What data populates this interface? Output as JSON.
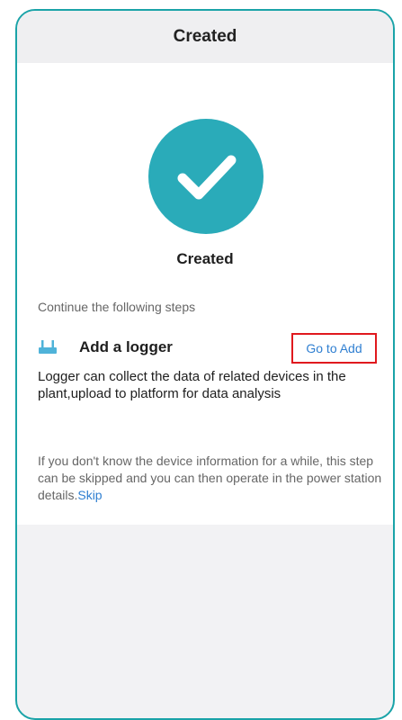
{
  "header": {
    "title": "Created"
  },
  "status": {
    "icon": "checkmark-circle-icon",
    "label": "Created"
  },
  "steps": {
    "intro": "Continue the following steps",
    "logger": {
      "icon": "router-icon",
      "title": "Add a logger",
      "action_label": "Go to Add",
      "description": "Logger can collect the data of related devices in the plant,upload to platform for data analysis"
    },
    "skip_note": "If you don't know the device information for a while, this step can be skipped and you can then operate in the power station details.",
    "skip_label": "Skip"
  },
  "colors": {
    "accent": "#2aabb9",
    "link": "#2f7fd1",
    "highlight_border": "#e0191e",
    "frame_border": "#1aa3a8"
  }
}
